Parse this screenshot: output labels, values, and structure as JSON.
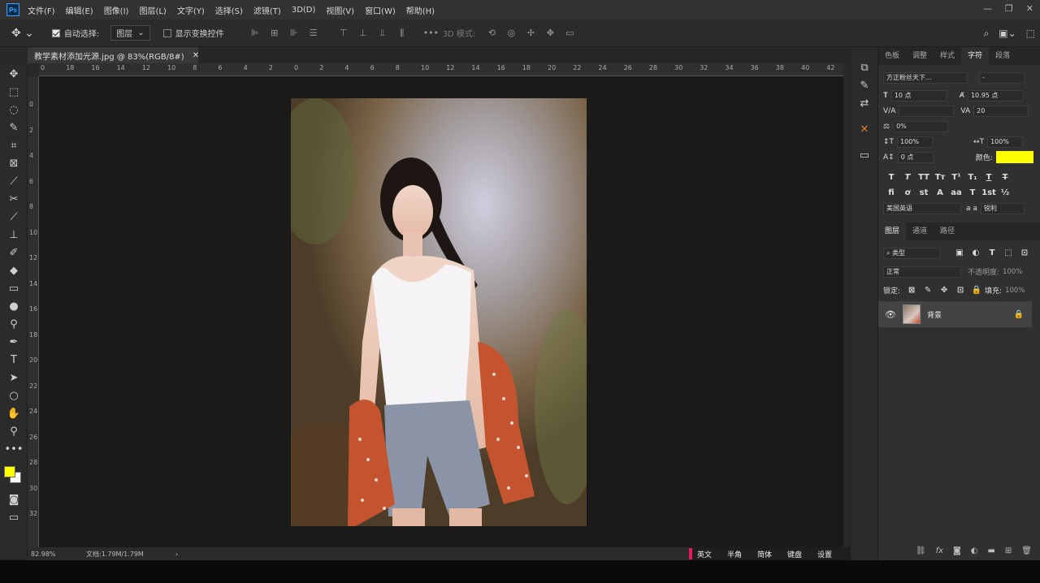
{
  "menubar": {
    "logo": "Ps",
    "items": [
      "文件(F)",
      "编辑(E)",
      "图像(I)",
      "图层(L)",
      "文字(Y)",
      "选择(S)",
      "滤镜(T)",
      "3D(D)",
      "视图(V)",
      "窗口(W)",
      "帮助(H)"
    ]
  },
  "options": {
    "auto_select_label": "自动选择:",
    "auto_select_value": "图层",
    "show_transform_label": "显示变换控件",
    "mode_3d_label": "3D 模式:"
  },
  "document": {
    "tab_title": "教学素材添加光源.jpg @ 83%(RGB/8#)",
    "zoom": "82.98%",
    "doc_info": "文档:1.79M/1.79M"
  },
  "rulers": {
    "top": [
      "0",
      "18",
      "16",
      "14",
      "12",
      "10",
      "8",
      "6",
      "4",
      "2",
      "0",
      "2",
      "4",
      "6",
      "8",
      "10",
      "12",
      "14",
      "16",
      "18",
      "20",
      "22",
      "24",
      "26",
      "28",
      "30",
      "32",
      "34",
      "36",
      "38",
      "40",
      "42"
    ],
    "left": [
      "0",
      "2",
      "4",
      "6",
      "8",
      "10",
      "12",
      "14",
      "16",
      "18",
      "20",
      "22",
      "24",
      "26",
      "28",
      "30",
      "32"
    ]
  },
  "character_panel": {
    "tabs": [
      "色板",
      "调整",
      "样式",
      "字符",
      "段落"
    ],
    "active_tab": "字符",
    "font_family": "方正粉丝天下...",
    "font_style": "-",
    "font_size": "10 点",
    "leading": "10.95 点",
    "kerning": "",
    "tracking": "20",
    "vscale_pct": "0%",
    "vertical_scale": "100%",
    "horizontal_scale": "100%",
    "baseline": "0 点",
    "color_label": "颜色:",
    "color_value": "#ffff00",
    "language": "美国英语",
    "aa_label": "a a",
    "antialias": "锐利"
  },
  "layers_panel": {
    "tabs": [
      "图层",
      "通道",
      "路径"
    ],
    "active_tab": "图层",
    "filter_label": "类型",
    "blend_mode": "正常",
    "opacity_label": "不透明度:",
    "opacity": "100%",
    "lock_label": "锁定:",
    "fill_label": "填充:",
    "fill": "100%",
    "layers": [
      {
        "name": "背景",
        "locked": true,
        "visible": true
      }
    ]
  },
  "ime": {
    "items": [
      "英文",
      "半角",
      "简体",
      "键盘",
      "设置"
    ]
  },
  "colors": {
    "foreground": "#ffff00",
    "background": "#ffffff",
    "accent": "#31a8ff"
  }
}
